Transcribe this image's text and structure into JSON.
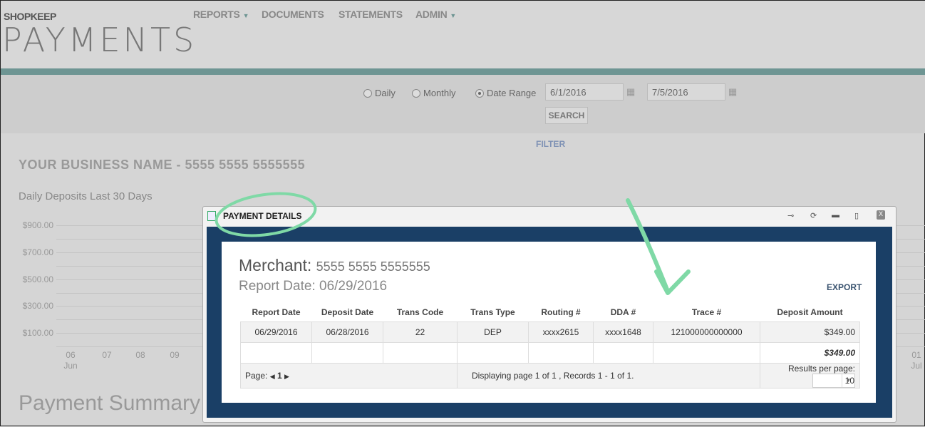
{
  "header": {
    "brand": "SHOPKEEP",
    "logo": "PAYMENTS",
    "nav": [
      {
        "label": "REPORTS",
        "dropdown": true
      },
      {
        "label": "DOCUMENTS"
      },
      {
        "label": "STATEMENTS"
      },
      {
        "label": "ADMIN",
        "dropdown": true
      }
    ]
  },
  "filter": {
    "options": [
      {
        "label": "Daily",
        "selected": false
      },
      {
        "label": "Monthly",
        "selected": false
      },
      {
        "label": "Date Range",
        "selected": true
      }
    ],
    "start_date": "6/1/2016",
    "end_date": "7/5/2016",
    "search_label": "SEARCH",
    "filter_label": "FILTER"
  },
  "business_title": "YOUR BUSINESS NAME - 5555 5555 5555555",
  "chart_data": {
    "type": "bar",
    "title": "Daily Deposits Last 30 Days",
    "y_ticks": [
      "$900.00",
      "$700.00",
      "$500.00",
      "$300.00",
      "$100.00"
    ],
    "x_ticks": [
      {
        "day": "06",
        "month": "Jun"
      },
      {
        "day": "07"
      },
      {
        "day": "08"
      },
      {
        "day": "09"
      },
      {
        "day": "01",
        "month": "Jul"
      }
    ]
  },
  "payment_summary": "Payment Summary",
  "modal": {
    "title": "PAYMENT DETAILS",
    "merchant_label": "Merchant:",
    "merchant_id": "5555 5555 5555555",
    "report_date": "Report Date: 06/29/2016",
    "export_label": "EXPORT",
    "columns": [
      "Report Date",
      "Deposit Date",
      "Trans Code",
      "Trans Type",
      "Routing #",
      "DDA #",
      "Trace #",
      "Deposit Amount"
    ],
    "rows": [
      [
        "06/29/2016",
        "06/28/2016",
        "22",
        "DEP",
        "xxxx2615",
        "xxxx1648",
        "121000000000000",
        "$349.00"
      ]
    ],
    "total": "$349.00",
    "page_label": "Page:",
    "page": "1",
    "display_text": "Displaying page 1 of 1 , Records 1 - 1 of 1.",
    "rpp_label": "Results per page:",
    "rpp": "10"
  },
  "colors": {
    "teal": "#6e9593",
    "modal_blue": "#1a3f66",
    "annotation": "#7fd9a6"
  }
}
